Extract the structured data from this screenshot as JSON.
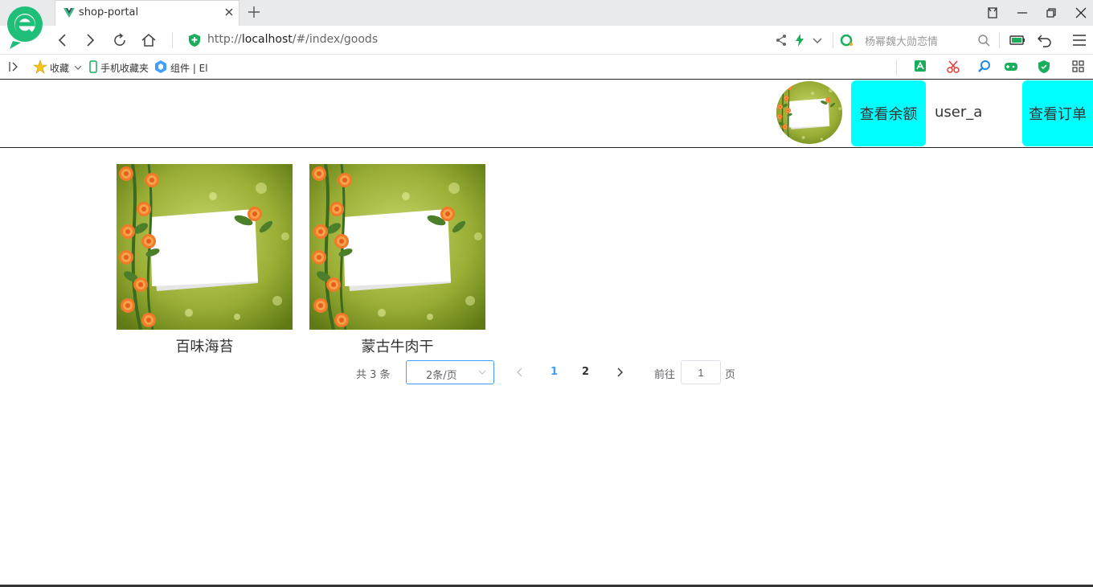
{
  "browser": {
    "tab_title": "shop-portal",
    "url_prefix": "http://",
    "url_host": "localhost",
    "url_path": "/#/index/goods",
    "search_placeholder": "杨幂魏大勋恋情",
    "accent_color": "#1aad5b"
  },
  "bookmarks": {
    "favorites": "收藏",
    "mobile_favorites": "手机收藏夹",
    "components": "组件 | El"
  },
  "header": {
    "balance_button": "查看余额",
    "username": "user_a",
    "orders_button": "查看订单",
    "button_color": "#00ffff"
  },
  "goods": [
    {
      "name": "百味海苔",
      "icon": "flower-frame-image"
    },
    {
      "name": "蒙古牛肉干",
      "icon": "flower-frame-image"
    }
  ],
  "pagination": {
    "total_text": "共 3 条",
    "page_size": "2条/页",
    "pages": [
      "1",
      "2"
    ],
    "current_page": "1",
    "goto_label": "前往",
    "goto_value": "1",
    "page_suffix": "页",
    "active_color": "#409eff"
  }
}
